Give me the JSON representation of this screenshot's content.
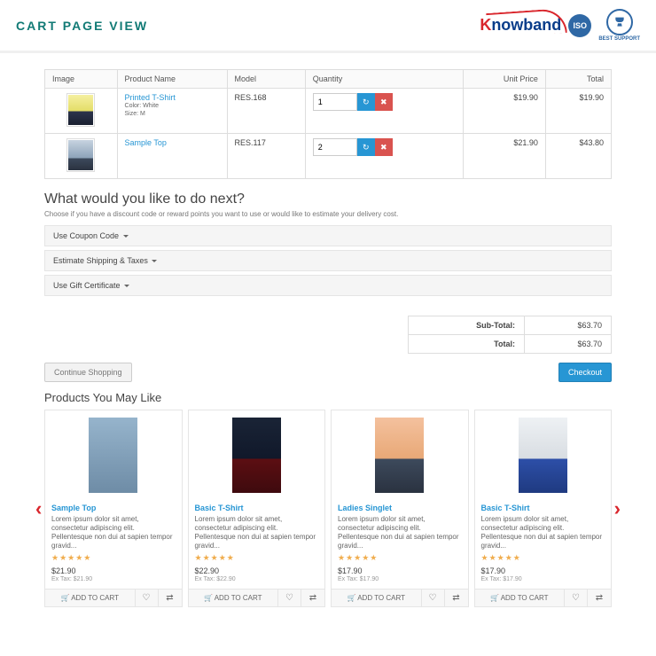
{
  "header": {
    "title": "CART PAGE VIEW",
    "brand": "nowband",
    "iso": "ISO",
    "best": "BEST SUPPORT"
  },
  "cart": {
    "cols": {
      "image": "Image",
      "name": "Product Name",
      "model": "Model",
      "qty": "Quantity",
      "unit": "Unit Price",
      "total": "Total"
    },
    "rows": [
      {
        "name": "Printed T-Shirt",
        "opts1": "Color: White",
        "opts2": "Size: M",
        "model": "RES.168",
        "qty": "1",
        "unit": "$19.90",
        "total": "$19.90",
        "ph": "ph1"
      },
      {
        "name": "Sample Top",
        "opts1": "",
        "opts2": "",
        "model": "RES.117",
        "qty": "2",
        "unit": "$21.90",
        "total": "$43.80",
        "ph": "ph2"
      }
    ]
  },
  "next": {
    "heading": "What would you like to do next?",
    "help": "Choose if you have a discount code or reward points you want to use or would like to estimate your delivery cost."
  },
  "acc": {
    "a": "Use Coupon Code",
    "b": "Estimate Shipping & Taxes",
    "c": "Use Gift Certificate"
  },
  "totals": {
    "sub_l": "Sub-Total:",
    "sub_v": "$63.70",
    "tot_l": "Total:",
    "tot_v": "$63.70"
  },
  "actions": {
    "cont": "Continue Shopping",
    "chk": "Checkout"
  },
  "like": {
    "title": "Products You May Like",
    "desc": "Lorem ipsum dolor sit amet, consectetur adipiscing elit. Pellentesque non dui at sapien tempor gravid...",
    "add": "ADD TO CART",
    "items": [
      {
        "t": "Sample Top",
        "p": "$21.90",
        "ex": "Ex Tax: $21.90",
        "ph": "ph3"
      },
      {
        "t": "Basic T-Shirt",
        "p": "$22.90",
        "ex": "Ex Tax: $22.90",
        "ph": "ph4"
      },
      {
        "t": "Ladies Singlet",
        "p": "$17.90",
        "ex": "Ex Tax: $17.90",
        "ph": "ph5"
      },
      {
        "t": "Basic T-Shirt",
        "p": "$17.90",
        "ex": "Ex Tax: $17.90",
        "ph": "ph6"
      }
    ]
  }
}
